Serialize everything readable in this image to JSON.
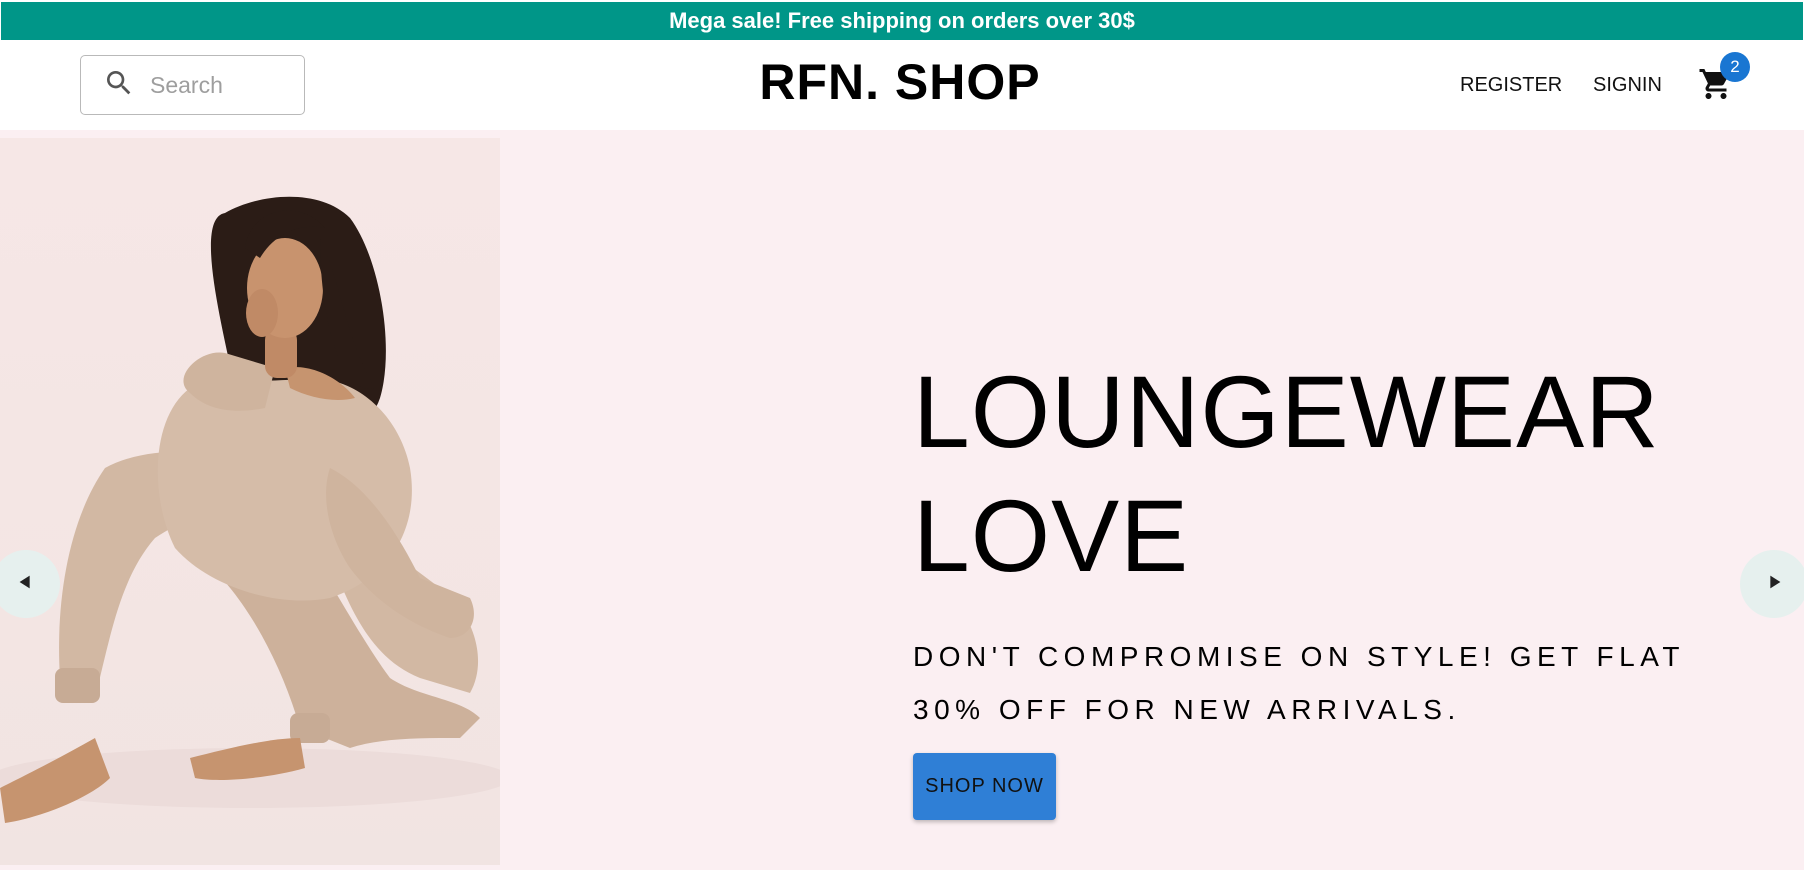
{
  "announcement": {
    "text": "Mega sale! Free shipping on orders over 30$"
  },
  "navbar": {
    "search": {
      "placeholder": "Search",
      "icon": "search-icon"
    },
    "logo": "RFN. SHOP",
    "links": {
      "register": "REGISTER",
      "signin": "SIGNIN"
    },
    "cart": {
      "icon": "shopping-cart-icon",
      "badge_count": "2"
    }
  },
  "hero": {
    "title_line1": "LOUNGEWEAR",
    "title_line2": "LOVE",
    "description": "DON'T COMPROMISE ON STYLE! GET FLAT 30% OFF FOR NEW ARRIVALS.",
    "cta_label": "SHOP NOW",
    "prev_icon": "arrow-left-icon",
    "next_icon": "arrow-right-icon"
  },
  "colors": {
    "announcement_bg": "#009688",
    "hero_bg": "#fbeff2",
    "button_bg": "#2f7fd6",
    "badge_bg": "#1976d2",
    "arrow_bg": "#e6f0ee"
  }
}
